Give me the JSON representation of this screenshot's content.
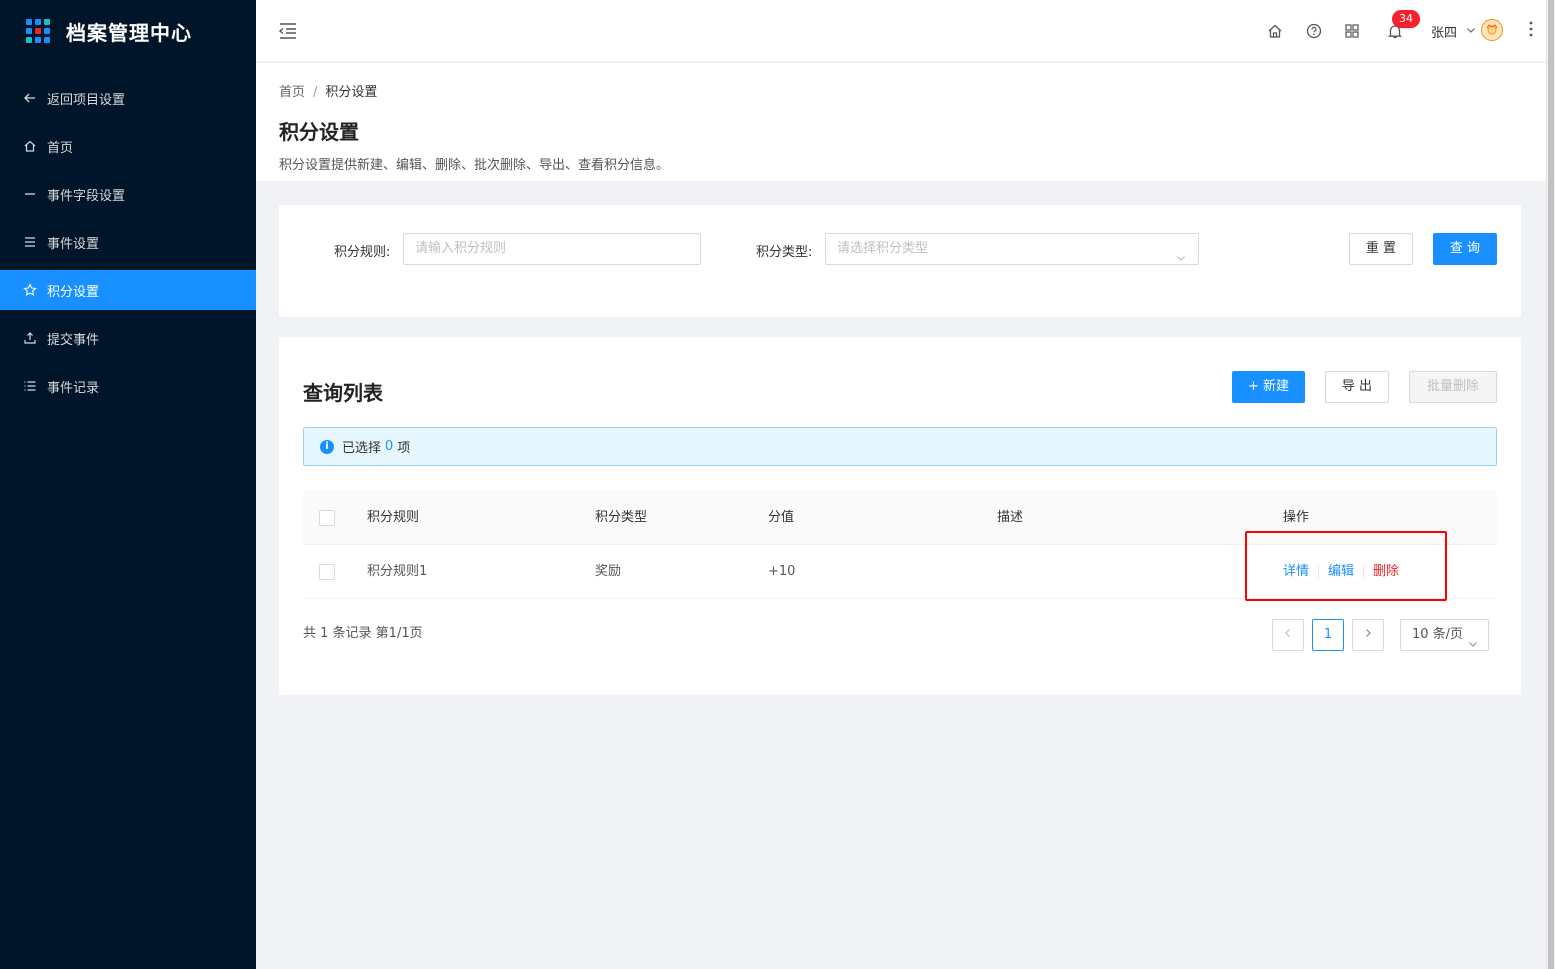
{
  "app": {
    "title": "档案管理中心"
  },
  "logo_colors": [
    "#1890ff",
    "#1890ff",
    "#13c2c2",
    "#1890ff",
    "#f5222d",
    "#1890ff",
    "#13c2c2",
    "#1890ff",
    "#1890ff"
  ],
  "sidebar": {
    "items": [
      {
        "label": "返回项目设置",
        "icon": "arrow-left-icon"
      },
      {
        "label": "首页",
        "icon": "home-icon"
      },
      {
        "label": "事件字段设置",
        "icon": "minus-icon"
      },
      {
        "label": "事件设置",
        "icon": "menu-icon"
      },
      {
        "label": "积分设置",
        "icon": "star-icon",
        "active": true
      },
      {
        "label": "提交事件",
        "icon": "upload-icon"
      },
      {
        "label": "事件记录",
        "icon": "list-icon"
      }
    ]
  },
  "header": {
    "notification_count": "34",
    "user_name": "张四"
  },
  "breadcrumb": {
    "home": "首页",
    "current": "积分设置"
  },
  "page": {
    "title": "积分设置",
    "description": "积分设置提供新建、编辑、删除、批次删除、导出、查看积分信息。"
  },
  "search": {
    "rule_label": "积分规则:",
    "rule_placeholder": "请输入积分规则",
    "type_label": "积分类型:",
    "type_placeholder": "请选择积分类型",
    "reset_label": "重 置",
    "query_label": "查 询"
  },
  "list": {
    "title": "查询列表",
    "new_label": "+ 新建",
    "export_label": "导 出",
    "batch_delete_label": "批量删除",
    "selected_prefix": "已选择",
    "selected_count": "0",
    "selected_suffix": "项",
    "columns": [
      "积分规则",
      "积分类型",
      "分值",
      "描述",
      "操作"
    ],
    "rows": [
      {
        "rule": "积分规则1",
        "type": "奖励",
        "score": "+10",
        "desc": ""
      }
    ],
    "actions": {
      "detail": "详情",
      "edit": "编辑",
      "delete": "删除"
    },
    "total_text": "共 1 条记录 第1/1页",
    "current_page": "1",
    "page_size": "10 条/页"
  }
}
